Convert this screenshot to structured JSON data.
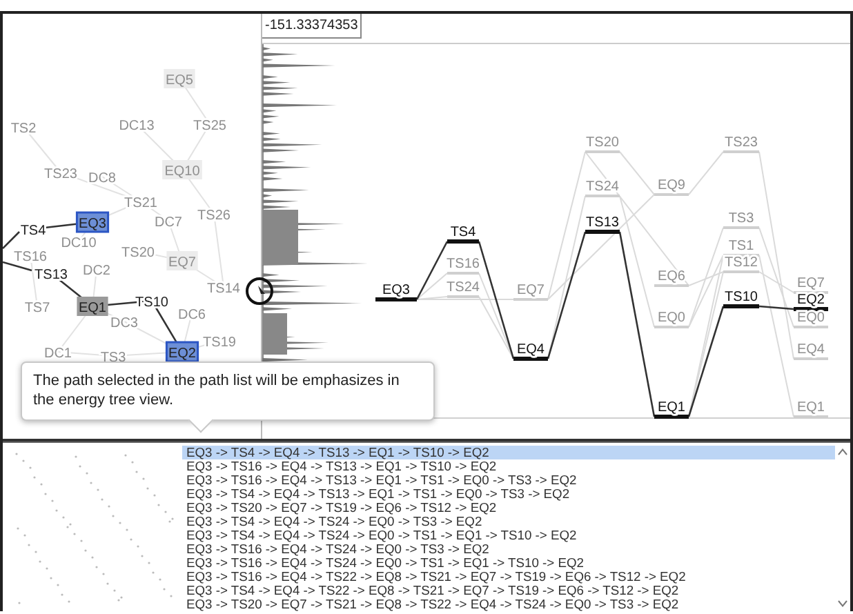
{
  "network": {
    "nodes": [
      {
        "label": "EQ5",
        "kind": "minimum",
        "emphasized": false
      },
      {
        "label": "DC13",
        "kind": "transition",
        "emphasized": false
      },
      {
        "label": "TS25",
        "kind": "transition",
        "emphasized": false
      },
      {
        "label": "TS23",
        "kind": "transition",
        "emphasized": false
      },
      {
        "label": "DC8",
        "kind": "transition",
        "emphasized": false
      },
      {
        "label": "EQ10",
        "kind": "minimum",
        "emphasized": false
      },
      {
        "label": "TS21",
        "kind": "transition",
        "emphasized": false
      },
      {
        "label": "DC7",
        "kind": "transition",
        "emphasized": false
      },
      {
        "label": "TS26",
        "kind": "transition",
        "emphasized": false
      },
      {
        "label": "DC10",
        "kind": "transition",
        "emphasized": false
      },
      {
        "label": "TS16",
        "kind": "transition",
        "emphasized": false
      },
      {
        "label": "TS20",
        "kind": "transition",
        "emphasized": false
      },
      {
        "label": "EQ7",
        "kind": "minimum",
        "emphasized": false
      },
      {
        "label": "DC2",
        "kind": "transition",
        "emphasized": false
      },
      {
        "label": "TS14",
        "kind": "transition",
        "emphasized": false
      },
      {
        "label": "TS7",
        "kind": "transition",
        "emphasized": false
      },
      {
        "label": "DC3",
        "kind": "transition",
        "emphasized": false
      },
      {
        "label": "DC6",
        "kind": "transition",
        "emphasized": false
      },
      {
        "label": "TS19",
        "kind": "transition",
        "emphasized": false
      },
      {
        "label": "DC1",
        "kind": "transition",
        "emphasized": false
      },
      {
        "label": "TS3",
        "kind": "transition",
        "emphasized": false
      },
      {
        "label": "TS2",
        "kind": "transition",
        "emphasized": false
      },
      {
        "label": "EQ3",
        "kind": "endpoint",
        "emphasized": true
      },
      {
        "label": "TS4",
        "kind": "transition",
        "emphasized": true
      },
      {
        "label": "TS13",
        "kind": "transition",
        "emphasized": true
      },
      {
        "label": "EQ1",
        "kind": "minimum",
        "emphasized": true
      },
      {
        "label": "TS10",
        "kind": "transition",
        "emphasized": true
      },
      {
        "label": "EQ2",
        "kind": "endpoint",
        "emphasized": true
      }
    ]
  },
  "energy": {
    "energy_field": {
      "value": "-151.33374353"
    },
    "levels": [
      {
        "label": "EQ3",
        "emphasized": true
      },
      {
        "label": "TS4",
        "emphasized": true
      },
      {
        "label": "TS16",
        "emphasized": false
      },
      {
        "label": "TS24",
        "emphasized": false
      },
      {
        "label": "EQ7",
        "emphasized": false
      },
      {
        "label": "EQ4",
        "emphasized": true
      },
      {
        "label": "TS20",
        "emphasized": false
      },
      {
        "label": "TS24",
        "emphasized": false
      },
      {
        "label": "TS13",
        "emphasized": true
      },
      {
        "label": "EQ9",
        "emphasized": false
      },
      {
        "label": "EQ6",
        "emphasized": false
      },
      {
        "label": "EQ0",
        "emphasized": false
      },
      {
        "label": "EQ1",
        "emphasized": true
      },
      {
        "label": "TS23",
        "emphasized": false
      },
      {
        "label": "TS3",
        "emphasized": false
      },
      {
        "label": "TS1",
        "emphasized": false
      },
      {
        "label": "TS12",
        "emphasized": false
      },
      {
        "label": "TS10",
        "emphasized": true
      },
      {
        "label": "EQ7",
        "emphasized": false
      },
      {
        "label": "EQ2",
        "emphasized": true
      },
      {
        "label": "EQ0",
        "emphasized": false
      },
      {
        "label": "EQ4",
        "emphasized": false
      },
      {
        "label": "EQ1",
        "emphasized": false
      }
    ]
  },
  "tooltip": {
    "text": "The path selected in the path list will be emphasizes in the energy tree view."
  },
  "path_list": {
    "rows": [
      {
        "text": "EQ3 -> TS4 -> EQ4 -> TS13 -> EQ1 -> TS10 -> EQ2",
        "selected": true
      },
      {
        "text": "EQ3 -> TS16 -> EQ4 -> TS13 -> EQ1 -> TS10 -> EQ2",
        "selected": false
      },
      {
        "text": "EQ3 -> TS16 -> EQ4 -> TS13 -> EQ1 -> TS1 -> EQ0 -> TS3 -> EQ2",
        "selected": false
      },
      {
        "text": "EQ3 -> TS4 -> EQ4 -> TS13 -> EQ1 -> TS1 -> EQ0 -> TS3 -> EQ2",
        "selected": false
      },
      {
        "text": "EQ3 -> TS20 -> EQ7 -> TS19 -> EQ6 -> TS12 -> EQ2",
        "selected": false
      },
      {
        "text": "EQ3 -> TS4 -> EQ4 -> TS24 -> EQ0 -> TS3 -> EQ2",
        "selected": false
      },
      {
        "text": "EQ3 -> TS4 -> EQ4 -> TS24 -> EQ0 -> TS1 -> EQ1 -> TS10 -> EQ2",
        "selected": false
      },
      {
        "text": "EQ3 -> TS16 -> EQ4 -> TS24 -> EQ0 -> TS3 -> EQ2",
        "selected": false
      },
      {
        "text": "EQ3 -> TS16 -> EQ4 -> TS24 -> EQ0 -> TS1 -> EQ1 -> TS10 -> EQ2",
        "selected": false
      },
      {
        "text": "EQ3 -> TS16 -> EQ4 -> TS22 -> EQ8 -> TS21 -> EQ7 -> TS19 -> EQ6 -> TS12 -> EQ2",
        "selected": false
      },
      {
        "text": "EQ3 -> TS4 -> EQ4 -> TS22 -> EQ8 -> TS21 -> EQ7 -> TS19 -> EQ6 -> TS12 -> EQ2",
        "selected": false
      },
      {
        "text": "EQ3 -> TS20 -> EQ7 -> TS21 -> EQ8 -> TS22 -> EQ4 -> TS24 -> EQ0 -> TS3 -> EQ2",
        "selected": false
      }
    ]
  }
}
